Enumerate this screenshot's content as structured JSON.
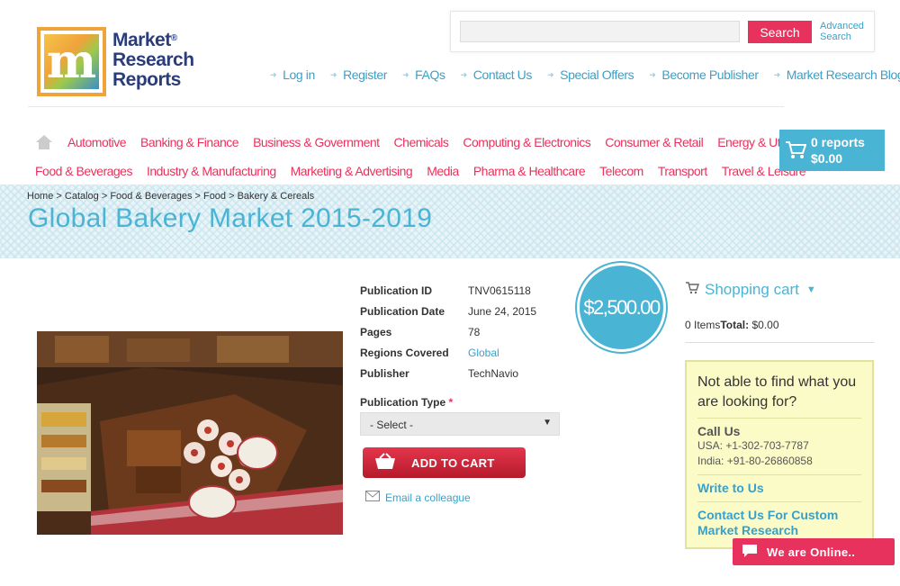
{
  "logo": {
    "line1": "Market",
    "line2": "Research",
    "line3": "Reports",
    "reg": "®",
    "mark": "m"
  },
  "search": {
    "button": "Search",
    "advanced_line1": "Advanced",
    "advanced_line2": "Search",
    "placeholder": ""
  },
  "topnav": [
    "Log in",
    "Register",
    "FAQs",
    "Contact Us",
    "Special Offers",
    "Become Publisher",
    "Market Research Blog"
  ],
  "categories": {
    "row1": [
      "Automotive",
      "Banking & Finance",
      "Business & Government",
      "Chemicals",
      "Computing & Electronics",
      "Consumer & Retail",
      "Energy & Utilities"
    ],
    "row2": [
      "Food & Beverages",
      "Industry & Manufacturing",
      "Marketing & Advertising",
      "Media",
      "Pharma & Healthcare",
      "Telecom",
      "Transport",
      "Travel & Leisure"
    ]
  },
  "cart_button": {
    "reports": "0 reports",
    "total": "$0.00"
  },
  "breadcrumb": "Home > Catalog > Food & Beverages > Food > Bakery & Cereals",
  "page_title": "Global Bakery Market 2015-2019",
  "details": [
    {
      "key": "Publication ID",
      "value": "TNV0615118"
    },
    {
      "key": "Publication Date",
      "value": "June 24, 2015"
    },
    {
      "key": "Pages",
      "value": "78"
    },
    {
      "key": "Regions Covered",
      "value": "Global"
    },
    {
      "key": "Publisher",
      "value": "TechNavio"
    }
  ],
  "publication_type": {
    "label": "Publication Type",
    "required": "*",
    "selected": "- Select -"
  },
  "add_to_cart": "ADD TO CART",
  "email_colleague": "Email a colleague",
  "price": "$2,500.00",
  "shopping_cart": {
    "title": "Shopping cart",
    "items": "0 Items",
    "total_label": "Total:",
    "total": "$0.00"
  },
  "help": {
    "heading": "Not able to find what you are looking for?",
    "call_label": "Call Us",
    "usa": "USA: +1-302-703-7787",
    "india": "India: +91-80-26860858",
    "write": "Write to Us",
    "custom": "Contact Us For Custom Market Research"
  },
  "online_chat": "We are Online..",
  "colors": {
    "accent_pink": "#e8325e",
    "accent_blue": "#4ab4d4"
  }
}
